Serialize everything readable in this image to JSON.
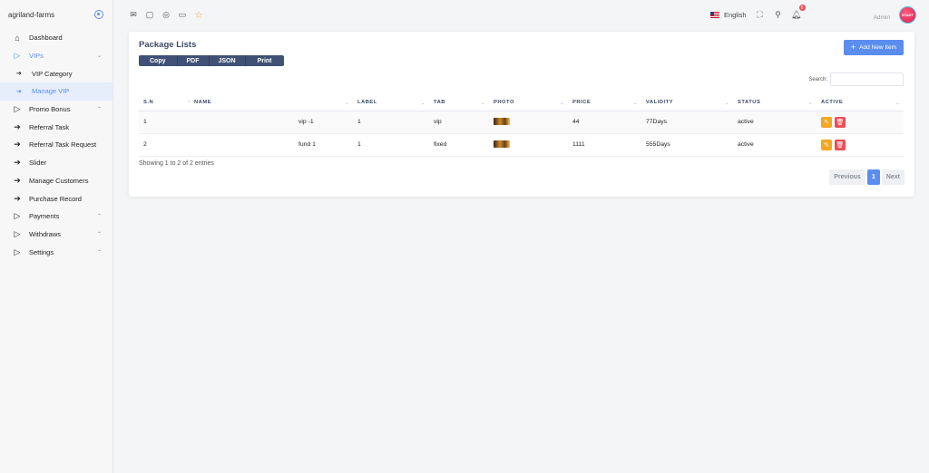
{
  "brand": {
    "name": "agriland-farms"
  },
  "sidebar": {
    "items": [
      {
        "label": "Dashboard",
        "icon": "home-icon"
      },
      {
        "label": "VIPs",
        "icon": "triangle-right-icon"
      },
      {
        "label": "VIP Category",
        "icon": "arrow-right-icon"
      },
      {
        "label": "Manage VIP",
        "icon": "arrow-right-icon"
      },
      {
        "label": "Promo Bonus",
        "icon": "triangle-right-icon"
      },
      {
        "label": "Referral Task",
        "icon": "arrow-right-icon"
      },
      {
        "label": "Referral Task Request",
        "icon": "arrow-right-icon"
      },
      {
        "label": "Slider",
        "icon": "arrow-right-icon"
      },
      {
        "label": "Manage Customers",
        "icon": "arrow-right-icon"
      },
      {
        "label": "Purchase Record",
        "icon": "arrow-right-icon"
      },
      {
        "label": "Payments",
        "icon": "triangle-right-icon"
      },
      {
        "label": "Withdraws",
        "icon": "triangle-right-icon"
      },
      {
        "label": "Settings",
        "icon": "triangle-right-icon"
      }
    ]
  },
  "topbar": {
    "language": "English",
    "notification_count": "6",
    "user": "Admin",
    "avatar_text": "START"
  },
  "card": {
    "title": "Package Lists",
    "add_label": "Add New Item",
    "export": {
      "copy": "Copy",
      "pdf": "PDF",
      "json": "JSON",
      "print": "Print"
    },
    "search_label": "Search:",
    "search_value": ""
  },
  "table": {
    "headers": [
      "S.N",
      "NAME",
      "LABEL",
      "TAB",
      "PHOTO",
      "PRICE",
      "VALIDITY",
      "STATUS",
      "ACTIVE"
    ],
    "rows": [
      {
        "sn": "1",
        "name": "vip -1",
        "label": "1",
        "tab": "vip",
        "price": "44",
        "validity": "77Days",
        "status": "active"
      },
      {
        "sn": "2",
        "name": "fund 1",
        "label": "1",
        "tab": "fixed",
        "price": "1111",
        "validity": "555Days",
        "status": "active"
      }
    ]
  },
  "footer": {
    "info": "Showing 1 to 2 of 2 entries",
    "prev": "Previous",
    "page": "1",
    "next": "Next"
  },
  "colors": {
    "accent": "#5b8def",
    "export_btn": "#3f5175",
    "edit": "#f5a623",
    "delete": "#ef4d56"
  }
}
